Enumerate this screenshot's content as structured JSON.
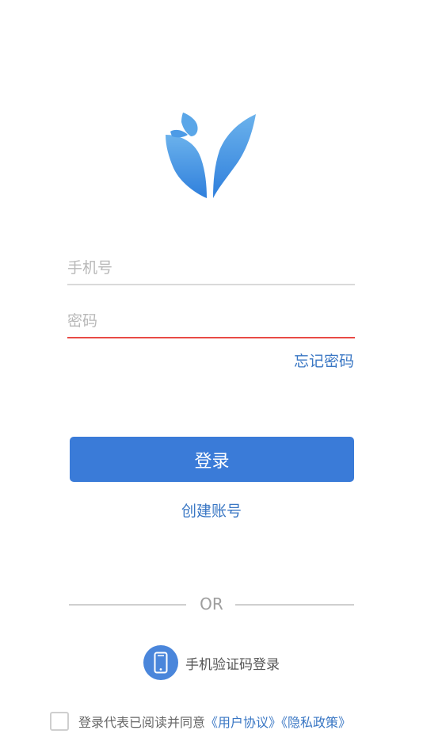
{
  "login": {
    "phone_placeholder": "手机号",
    "password_placeholder": "密码",
    "forgot_label": "忘记密码",
    "login_label": "登录",
    "create_label": "创建账号",
    "or_label": "OR",
    "sms_login_label": "手机验证码登录",
    "agreement_prefix": "登录代表已阅读并同意",
    "user_agreement_label": "《用户协议》",
    "privacy_policy_label": "《隐私政策》"
  },
  "icons": {
    "logo": "sprout-logo-icon",
    "phone": "phone-icon"
  },
  "colors": {
    "brand_blue": "#3a7bd8",
    "link_blue": "#3a77c4",
    "active_underline": "#e84a45"
  }
}
